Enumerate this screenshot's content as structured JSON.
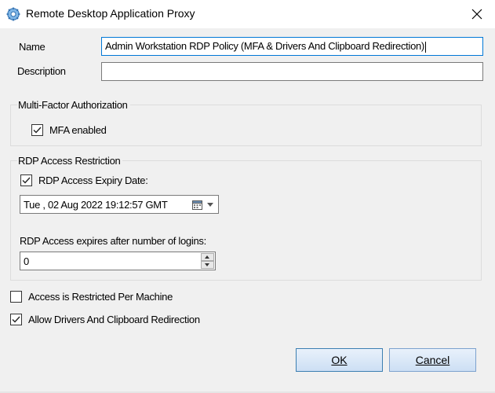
{
  "window": {
    "title": "Remote Desktop Application Proxy",
    "icon": "gear-icon",
    "close_icon": "close-icon"
  },
  "form": {
    "name_label": "Name",
    "name_value": "Admin Workstation RDP Policy (MFA & Drivers And Clipboard Redirection)",
    "description_label": "Description",
    "description_value": ""
  },
  "mfa_group": {
    "title": "Multi-Factor Authorization",
    "mfa_enabled_label": "MFA enabled",
    "mfa_enabled": true
  },
  "rdp_group": {
    "title": "RDP Access Restriction",
    "expiry_label": "RDP Access Expiry Date:",
    "expiry_checked": true,
    "expiry_date": "Tue , 02 Aug  2022 19:12:57 GMT",
    "logins_label": "RDP Access expires after number of logins:",
    "logins_value": "0"
  },
  "options": {
    "per_machine_label": "Access is Restricted Per Machine",
    "per_machine_checked": false,
    "drivers_label": "Allow Drivers And Clipboard Redirection",
    "drivers_checked": true
  },
  "buttons": {
    "ok": "OK",
    "cancel": "Cancel"
  },
  "colors": {
    "focus_border": "#0078d7",
    "button_border": "#7da2ce"
  }
}
